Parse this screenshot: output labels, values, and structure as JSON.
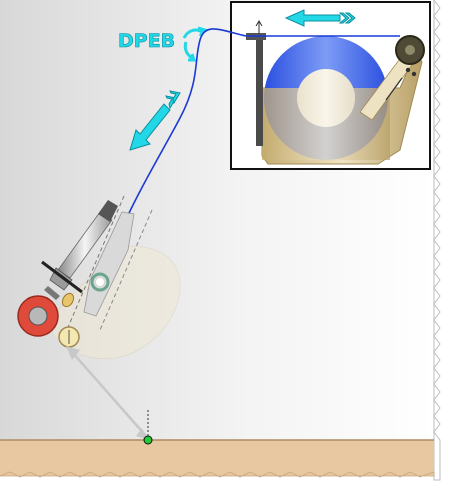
{
  "diagram": {
    "label_dpeb": "DPEB",
    "colors": {
      "background_light": "#f6f6f6",
      "background_dark": "#dcdcdc",
      "ground": "#e9c9a2",
      "wire": "#1a3ad6",
      "arrow": "#22d7e6",
      "spool_blue": "#2f56e8",
      "spool_body": "#c9b27b",
      "roller_red": "#e04a3a",
      "frame": "#111111"
    },
    "icons": {
      "flow_arrows": "chevron-arrow-icon",
      "reel": "wire-spool-icon",
      "roller": "feed-roller-icon"
    }
  }
}
